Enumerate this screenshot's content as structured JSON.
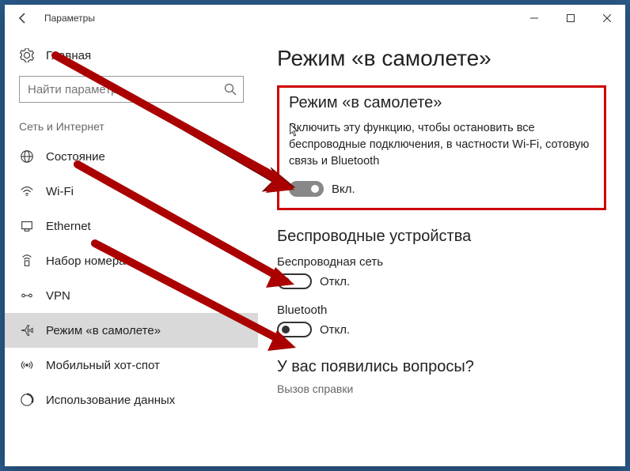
{
  "titlebar": {
    "title": "Параметры"
  },
  "sidebar": {
    "home": "Главная",
    "search_placeholder": "Найти параметр",
    "section_label": "Сеть и Интернет",
    "items": [
      {
        "label": "Состояние"
      },
      {
        "label": "Wi-Fi"
      },
      {
        "label": "Ethernet"
      },
      {
        "label": "Набор номера"
      },
      {
        "label": "VPN"
      },
      {
        "label": "Режим «в самолете»"
      },
      {
        "label": "Мобильный хот-спот"
      },
      {
        "label": "Использование данных"
      }
    ]
  },
  "content": {
    "page_title": "Режим «в самолете»",
    "airplane": {
      "title": "Режим «в самолете»",
      "desc": "Включить эту функцию, чтобы остановить все беспроводные подключения, в частности Wi-Fi, сотовую связь и Bluetooth",
      "state_label": "Вкл."
    },
    "wireless": {
      "heading": "Беспроводные устройства",
      "wifi_label": "Беспроводная сеть",
      "wifi_state": "Откл.",
      "bt_label": "Bluetooth",
      "bt_state": "Откл."
    },
    "help": {
      "heading": "У вас появились вопросы?",
      "link": "Вызов справки"
    }
  }
}
